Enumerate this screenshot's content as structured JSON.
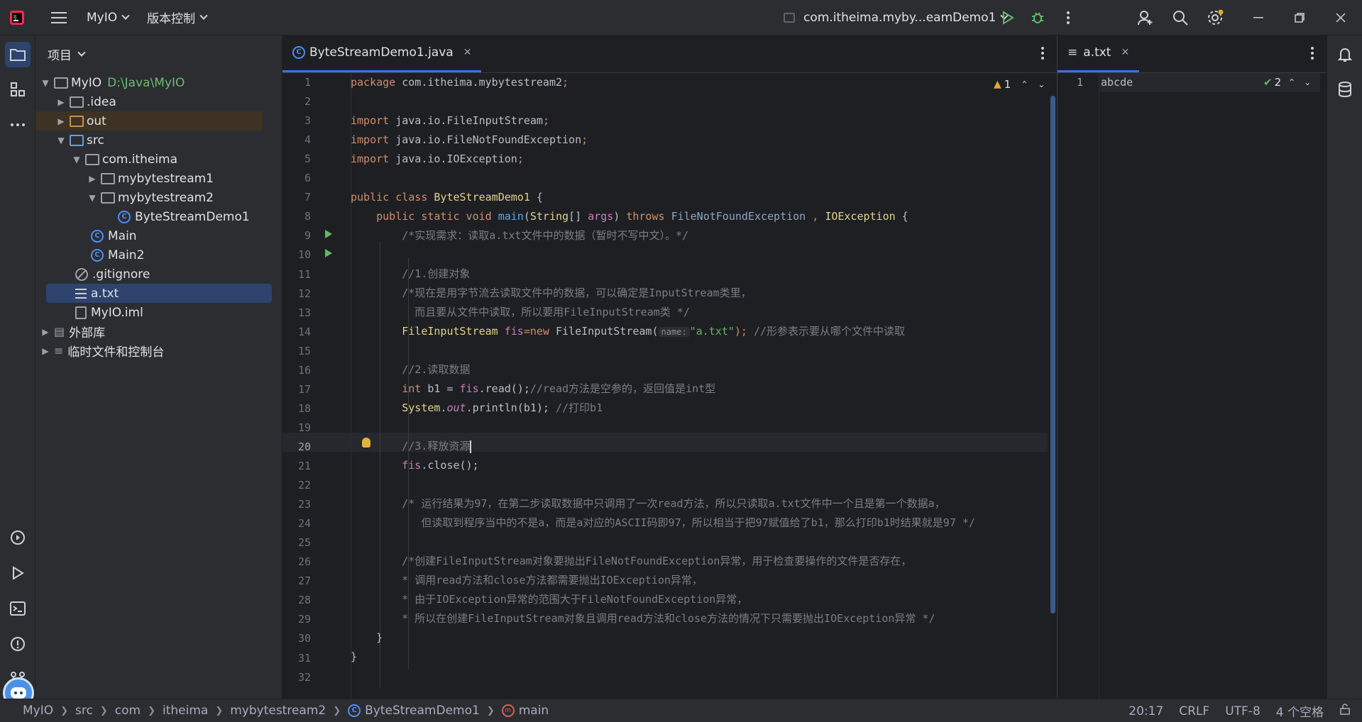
{
  "titlebar": {
    "project_name": "MyIO",
    "vcs_menu": "版本控制",
    "run_config": "com.itheima.myby...eamDemo1",
    "accent": "#3574f0"
  },
  "project_panel": {
    "title": "项目",
    "tree": [
      {
        "label": "MyIO",
        "extra": "D:\\Java\\MyIO",
        "icon": "module-folder-icon",
        "expanded": true
      },
      {
        "label": ".idea",
        "icon": "folder-icon",
        "expanded": false
      },
      {
        "label": "out",
        "icon": "excluded-folder-icon",
        "expanded": false
      },
      {
        "label": "src",
        "icon": "source-folder-icon",
        "expanded": true
      },
      {
        "label": "com.itheima",
        "icon": "package-icon",
        "expanded": true
      },
      {
        "label": "mybytestream1",
        "icon": "package-icon",
        "expanded": false
      },
      {
        "label": "mybytestream2",
        "icon": "package-icon",
        "expanded": true
      },
      {
        "label": "ByteStreamDemo1",
        "icon": "class-icon"
      },
      {
        "label": "Main",
        "icon": "class-icon"
      },
      {
        "label": "Main2",
        "icon": "class-icon"
      },
      {
        "label": ".gitignore",
        "icon": "ignore-file-icon"
      },
      {
        "label": "a.txt",
        "icon": "text-file-icon",
        "selected": true
      },
      {
        "label": "MyIO.iml",
        "icon": "iml-file-icon"
      },
      {
        "label": "外部库",
        "icon": "library-icon",
        "expanded": false
      },
      {
        "label": "临时文件和控制台",
        "icon": "scratch-icon",
        "expanded": false
      }
    ]
  },
  "editor": {
    "tab_label": "ByteStreamDemo1.java",
    "warnings": "1",
    "current_line": 20,
    "line_numbers": [
      "1",
      "2",
      "3",
      "4",
      "5",
      "6",
      "7",
      "8",
      "9",
      "10",
      "11",
      "12",
      "13",
      "14",
      "15",
      "16",
      "17",
      "18",
      "19",
      "20",
      "21",
      "22",
      "23",
      "24",
      "25",
      "26",
      "27",
      "28",
      "29",
      "30",
      "31",
      "32"
    ],
    "code": {
      "l1a": "package ",
      "l1b": "com.itheima.mybytestream2",
      "l1c": ";",
      "l3a": "import ",
      "l3b": "java.io.FileInputStream",
      "l3c": ";",
      "l4a": "import ",
      "l4b": "java.io.FileNotFoundException",
      "l4c": ";",
      "l5a": "import ",
      "l5b": "java.io.IOException",
      "l5c": ";",
      "l7a": "public class ",
      "l7b": "ByteStreamDemo1",
      "l7c": " {",
      "l8a": "    public static void ",
      "l8b": "main",
      "l8c": "(",
      "l8d": "String",
      "l8e": "[] ",
      "l8f": "args",
      "l8g": ") ",
      "l8h": "throws ",
      "l8i": "FileNotFoundException",
      "l8j": " , ",
      "l8k": "IOException",
      "l8l": " {",
      "l9": "        /*实现需求：读取a.txt文件中的数据（暂时不写中文）。*/",
      "l11": "        //1.创建对象",
      "l12": "        /*现在是用字节流去读取文件中的数据，可以确定是InputStream类里，",
      "l13": "          而且要从文件中读取，所以要用FileInputStream类 */",
      "l14a": "        ",
      "l14b": "FileInputStream",
      "l14c": " fis",
      "l14d": "=",
      "l14e": "new ",
      "l14f": "FileInputStream(",
      "l14g": "name:",
      "l14h": "\"a.txt\"",
      "l14i": "); ",
      "l14j": "//形参表示要从哪个文件中读取",
      "l16": "        //2.读取数据",
      "l17a": "        ",
      "l17b": "int ",
      "l17c": "b1 = ",
      "l17d": "fis",
      "l17e": ".read();",
      "l17f": "//read方法是空参的，返回值是int型",
      "l18a": "        ",
      "l18b": "System",
      "l18c": ".",
      "l18d": "out",
      "l18e": ".println(b1); ",
      "l18f": "//打印b1",
      "l20": "        //3.释放资源",
      "l21a": "        ",
      "l21b": "fis",
      "l21c": ".close();",
      "l23": "        /* 运行结果为97，在第二步读取数据中只调用了一次read方法，所以只读取a.txt文件中一个且是第一个数据a，",
      "l24": "           但读取到程序当中的不是a，而是a对应的ASCII码即97，所以相当于把97赋值给了b1，那么打印b1时结果就是97 */",
      "l26": "        /*创建FileInputStream对象要抛出FileNotFoundException异常，用于检查要操作的文件是否存在，",
      "l27": "        * 调用read方法和close方法都需要抛出IOException异常，",
      "l28": "        * 由于IOException异常的范围大于FileNotFoundException异常，",
      "l29": "        * 所以在创建FileInputStream对象且调用read方法和close方法的情况下只需要抛出IOException异常 */",
      "l30": "    }",
      "l31": "}"
    }
  },
  "editor2": {
    "tab_label": "a.txt",
    "line_number": "1",
    "content": "abcde",
    "checks": "2"
  },
  "statusbar": {
    "breadcrumbs": [
      "MyIO",
      "src",
      "com",
      "itheima",
      "mybytestream2",
      "ByteStreamDemo1",
      "main"
    ],
    "position": "20:17",
    "line_sep": "CRLF",
    "encoding": "UTF-8",
    "indent": "4 个空格"
  }
}
